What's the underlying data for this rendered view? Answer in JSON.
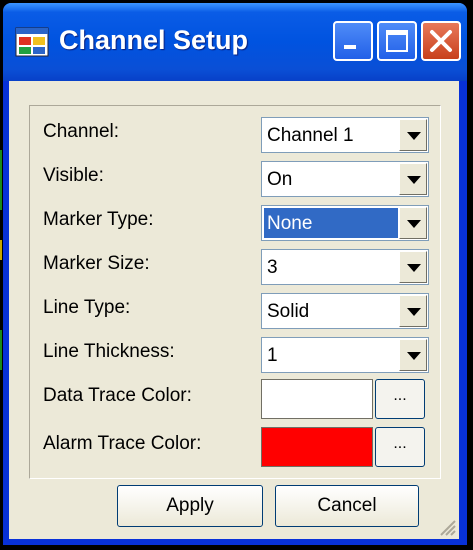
{
  "window": {
    "title": "Channel Setup",
    "app_icon": "app-window-icon",
    "controls": [
      "minimize-icon",
      "maximize-icon",
      "close-icon"
    ]
  },
  "form": {
    "channel": {
      "label": "Channel:",
      "value": "Channel 1"
    },
    "visible": {
      "label": "Visible:",
      "value": "On"
    },
    "marker_type": {
      "label": "Marker Type:",
      "value": "None"
    },
    "marker_size": {
      "label": "Marker Size:",
      "value": "3"
    },
    "line_type": {
      "label": "Line Type:",
      "value": "Solid"
    },
    "line_thickness": {
      "label": "Line Thickness:",
      "value": "1"
    },
    "data_trace_color": {
      "label": "Data Trace Color:",
      "color": "#ffffff",
      "button": "..."
    },
    "alarm_trace_color": {
      "label": "Alarm Trace Color:",
      "color": "#ff0000",
      "button": "..."
    }
  },
  "buttons": {
    "apply": "Apply",
    "cancel": "Cancel"
  },
  "colors": {
    "title_bar": "#0053e0",
    "selection": "#316ac5",
    "face": "#ece9d8"
  }
}
